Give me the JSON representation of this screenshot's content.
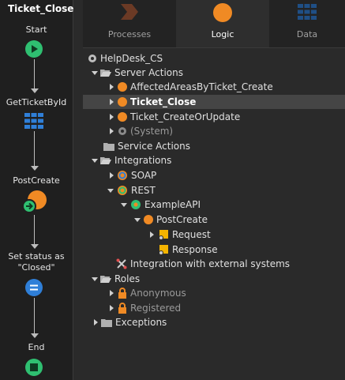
{
  "flow": {
    "title": "Ticket_Close",
    "nodes": {
      "start": "Start",
      "get_ticket": "GetTicketById",
      "post_create": "PostCreate",
      "set_status_line1": "Set status as",
      "set_status_line2": "\"Closed\"",
      "end": "End"
    }
  },
  "tabs": [
    {
      "label": "Processes",
      "active": false
    },
    {
      "label": "Logic",
      "active": true
    },
    {
      "label": "Data",
      "active": false
    }
  ],
  "tree": {
    "root": "HelpDesk_CS",
    "server_actions": "Server Actions",
    "server_items": [
      "AffectedAreasByTicket_Create",
      "Ticket_Close",
      "Ticket_CreateOrUpdate",
      "(System)"
    ],
    "service_actions": "Service Actions",
    "integrations": "Integrations",
    "soap": "SOAP",
    "rest": "REST",
    "example_api": "ExampleAPI",
    "post_create": "PostCreate",
    "request": "Request",
    "response": "Response",
    "integration_external": "Integration with external systems",
    "roles": "Roles",
    "role_items": [
      "Anonymous",
      "Registered"
    ],
    "exceptions": "Exceptions"
  },
  "colors": {
    "accent_orange": "#f08a24",
    "flow_green": "#2fbf71",
    "blue": "#2f7fd8",
    "selected_row": "#454545"
  }
}
